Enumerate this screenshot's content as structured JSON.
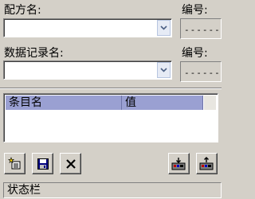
{
  "recipe": {
    "label": "配方名:",
    "value": "",
    "number_label": "编号:",
    "number_value": "------"
  },
  "record": {
    "label": "数据记录名:",
    "value": "",
    "number_label": "编号:",
    "number_value": "------"
  },
  "entries_table": {
    "columns": [
      "条目名",
      "值"
    ],
    "rows": []
  },
  "toolbar": {
    "left": [
      "new-record",
      "save",
      "delete"
    ],
    "right": [
      "import",
      "export"
    ]
  },
  "status_bar": {
    "text": "状态栏"
  }
}
